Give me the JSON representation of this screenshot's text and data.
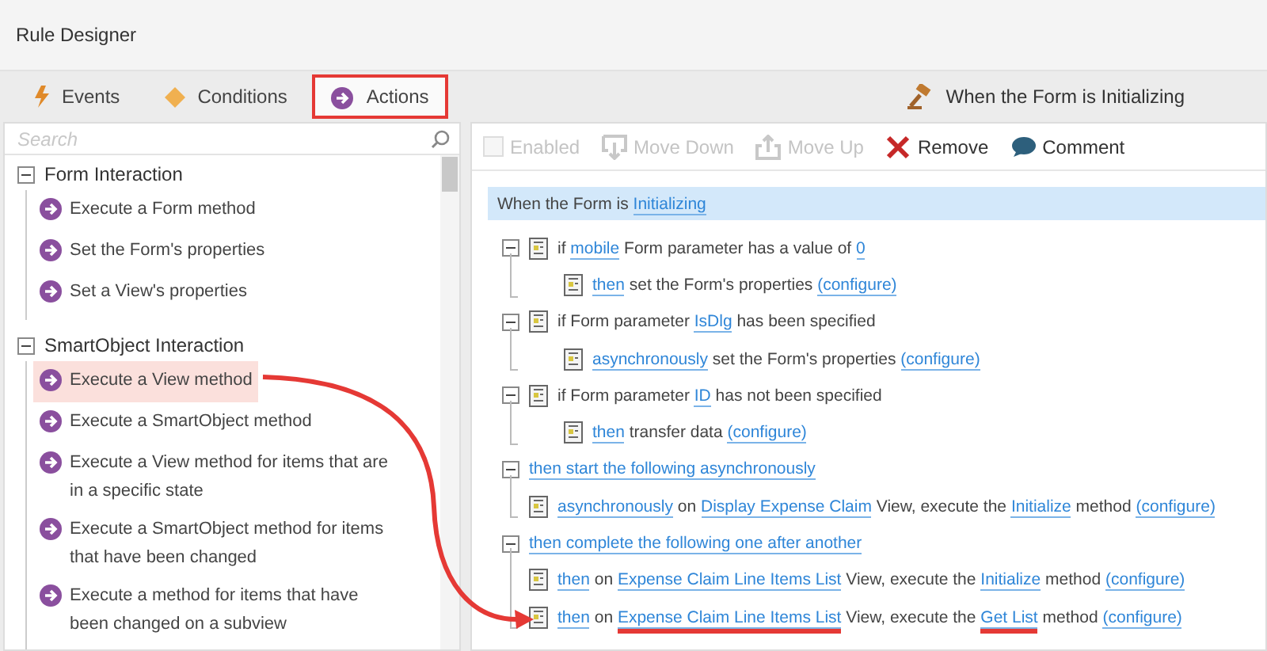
{
  "window": {
    "title": "Rule Designer"
  },
  "tabs": [
    {
      "label": "Events",
      "kind": "events",
      "selected": false,
      "annotated": false
    },
    {
      "label": "Conditions",
      "kind": "conditions",
      "selected": false,
      "annotated": false
    },
    {
      "label": "Actions",
      "kind": "actions",
      "selected": true,
      "annotated": true
    }
  ],
  "search": {
    "placeholder": "Search"
  },
  "tree": [
    {
      "label": "Form Interaction",
      "expanded": true,
      "children": [
        {
          "label": "Execute a Form method",
          "selected": false
        },
        {
          "label": "Set the Form's properties",
          "selected": false
        },
        {
          "label": "Set a View's properties",
          "selected": false
        }
      ]
    },
    {
      "label": "SmartObject Interaction",
      "expanded": true,
      "children": [
        {
          "label": "Execute a View method",
          "selected": true
        },
        {
          "label": "Execute a SmartObject method",
          "selected": false
        },
        {
          "label": "Execute a View method for items that are in a specific state",
          "selected": false
        },
        {
          "label": "Execute a SmartObject method for items that have been changed",
          "selected": false
        },
        {
          "label": "Execute a method for items that have been changed on a subview",
          "selected": false
        }
      ]
    }
  ],
  "rule_title": "When the Form is Initializing",
  "toolbar": [
    {
      "label": "Enabled",
      "kind": "checkbox",
      "disabled": true,
      "checked": false
    },
    {
      "label": "Move Down",
      "kind": "move-down",
      "disabled": true
    },
    {
      "label": "Move Up",
      "kind": "move-up",
      "disabled": true
    },
    {
      "label": "Remove",
      "kind": "remove",
      "disabled": false
    },
    {
      "label": "Comment",
      "kind": "comment",
      "disabled": false
    }
  ],
  "rule_header": [
    {
      "text": "When the Form is",
      "link": false
    },
    {
      "text": "Initializing",
      "link": true
    }
  ],
  "rules": [
    {
      "kind": "condition",
      "expanded": true,
      "parts": [
        {
          "text": "if",
          "link": false
        },
        {
          "text": "mobile",
          "link": true
        },
        {
          "text": "Form parameter has a value of",
          "link": false
        },
        {
          "text": "0",
          "link": true
        }
      ],
      "children": [
        {
          "parts": [
            {
              "text": "then",
              "link": true
            },
            {
              "text": "set the Form's properties",
              "link": false
            },
            {
              "text": "(configure)",
              "link": true
            }
          ]
        }
      ]
    },
    {
      "kind": "condition",
      "expanded": true,
      "parts": [
        {
          "text": "if Form parameter",
          "link": false
        },
        {
          "text": "IsDlg",
          "link": true
        },
        {
          "text": "has been specified",
          "link": false
        }
      ],
      "children": [
        {
          "parts": [
            {
              "text": "asynchronously",
              "link": true
            },
            {
              "text": "set the Form's properties",
              "link": false
            },
            {
              "text": "(configure)",
              "link": true
            }
          ]
        }
      ]
    },
    {
      "kind": "condition",
      "expanded": true,
      "parts": [
        {
          "text": "if Form parameter",
          "link": false
        },
        {
          "text": "ID",
          "link": true
        },
        {
          "text": "has not been specified",
          "link": false
        }
      ],
      "children": [
        {
          "parts": [
            {
              "text": "then",
              "link": true
            },
            {
              "text": "transfer data",
              "link": false
            },
            {
              "text": "(configure)",
              "link": true
            }
          ]
        }
      ]
    },
    {
      "kind": "group",
      "expanded": true,
      "parts": [
        {
          "text": "then start the following asynchronously",
          "link": true
        }
      ],
      "children": [
        {
          "parts": [
            {
              "text": "asynchronously",
              "link": true
            },
            {
              "text": "on",
              "link": false
            },
            {
              "text": "Display Expense Claim",
              "link": true
            },
            {
              "text": "View, execute the",
              "link": false
            },
            {
              "text": "Initialize",
              "link": true
            },
            {
              "text": "method",
              "link": false
            },
            {
              "text": "(configure)",
              "link": true
            }
          ]
        }
      ]
    },
    {
      "kind": "group",
      "expanded": true,
      "parts": [
        {
          "text": "then complete the following one after another",
          "link": true
        }
      ],
      "children": [
        {
          "parts": [
            {
              "text": "then",
              "link": true
            },
            {
              "text": "on",
              "link": false
            },
            {
              "text": "Expense Claim Line Items List",
              "link": true
            },
            {
              "text": "View, execute the",
              "link": false
            },
            {
              "text": "Initialize",
              "link": true
            },
            {
              "text": "method",
              "link": false
            },
            {
              "text": "(configure)",
              "link": true
            }
          ]
        },
        {
          "parts": [
            {
              "text": "then",
              "link": true
            },
            {
              "text": "on",
              "link": false
            },
            {
              "text": "Expense Claim Line Items List",
              "link": true,
              "marked": true
            },
            {
              "text": "View, execute the",
              "link": false
            },
            {
              "text": "Get List",
              "link": true,
              "marked": true
            },
            {
              "text": "method",
              "link": false
            },
            {
              "text": "(configure)",
              "link": true
            }
          ]
        }
      ]
    }
  ]
}
